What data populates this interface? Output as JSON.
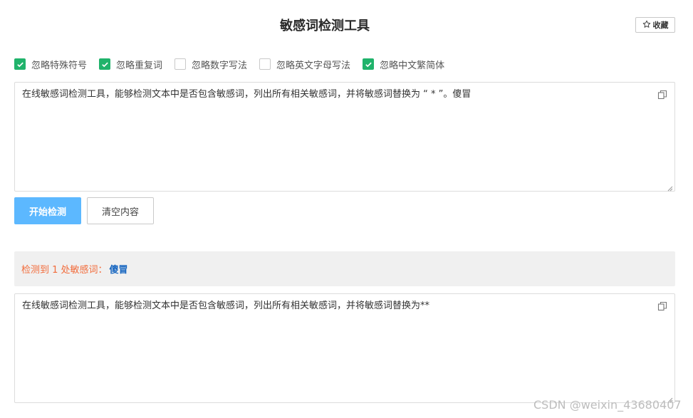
{
  "header": {
    "title": "敏感词检测工具",
    "favorite_label": "收藏"
  },
  "options": [
    {
      "label": "忽略特殊符号",
      "checked": true
    },
    {
      "label": "忽略重复词",
      "checked": true
    },
    {
      "label": "忽略数字写法",
      "checked": false
    },
    {
      "label": "忽略英文字母写法",
      "checked": false
    },
    {
      "label": "忽略中文繁简体",
      "checked": true
    }
  ],
  "input": {
    "value": "在线敏感词检测工具，能够检测文本中是否包含敏感词，列出所有相关敏感词，并将敏感词替换为 “ * ”。傻冒"
  },
  "buttons": {
    "start_label": "开始检测",
    "clear_label": "清空内容"
  },
  "result": {
    "prefix": "检测到 1 处敏感词：",
    "word": "傻冒"
  },
  "output": {
    "value": "在线敏感词检测工具，能够检测文本中是否包含敏感词，列出所有相关敏感词，并将敏感词替换为**"
  },
  "watermark": "CSDN @weixin_43680407",
  "colors": {
    "accent_green": "#20b36b",
    "primary_button": "#5cb8ff",
    "result_prefix": "#f26b3a",
    "result_word": "#1565c0"
  },
  "icons": {
    "favorite": "star-outline-icon",
    "copy": "copy-icon",
    "checkbox_checked": "check-icon"
  }
}
